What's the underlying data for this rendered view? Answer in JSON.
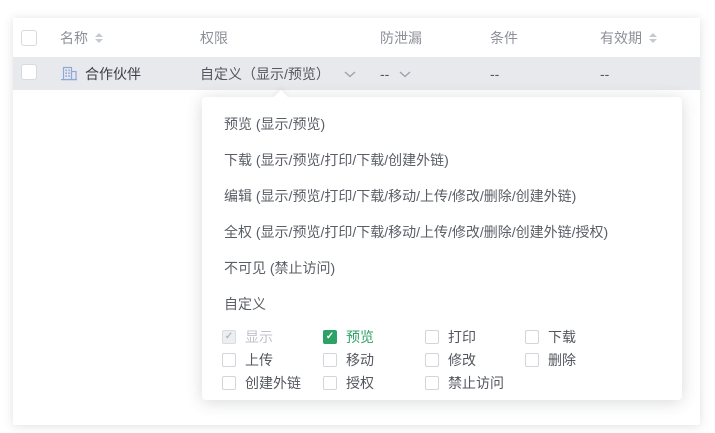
{
  "table": {
    "columns": [
      {
        "label": "名称",
        "sortable": true
      },
      {
        "label": "权限",
        "sortable": false
      },
      {
        "label": "防泄漏",
        "sortable": false
      },
      {
        "label": "条件",
        "sortable": false
      },
      {
        "label": "有效期",
        "sortable": true
      }
    ],
    "row": {
      "name": "合作伙伴",
      "permission": "自定义（显示/预览）",
      "leak_prevention": "--",
      "condition": "--",
      "validity": "--"
    }
  },
  "dropdown": {
    "options": [
      "预览 (显示/预览)",
      "下载 (显示/预览/打印/下载/创建外链)",
      "编辑 (显示/预览/打印/下载/移动/上传/修改/删除/创建外链)",
      "全权 (显示/预览/打印/下载/移动/上传/修改/删除/创建外链/授权)",
      "不可见 (禁止访问)"
    ],
    "custom_label": "自定义",
    "checkboxes": [
      {
        "label": "显示",
        "state": "checked-disabled"
      },
      {
        "label": "预览",
        "state": "checked"
      },
      {
        "label": "打印",
        "state": "unchecked"
      },
      {
        "label": "下载",
        "state": "unchecked"
      },
      {
        "label": "上传",
        "state": "unchecked"
      },
      {
        "label": "移动",
        "state": "unchecked"
      },
      {
        "label": "修改",
        "state": "unchecked"
      },
      {
        "label": "删除",
        "state": "unchecked"
      },
      {
        "label": "创建外链",
        "state": "unchecked"
      },
      {
        "label": "授权",
        "state": "unchecked"
      },
      {
        "label": "禁止访问",
        "state": "unchecked"
      }
    ]
  },
  "glyphs": {
    "check": "✓"
  },
  "colors": {
    "accent_green": "#2EA167",
    "row_selected_bg": "#E7E9ED",
    "icon_blue": "#8FA7DB",
    "header_text": "#8C9097"
  }
}
